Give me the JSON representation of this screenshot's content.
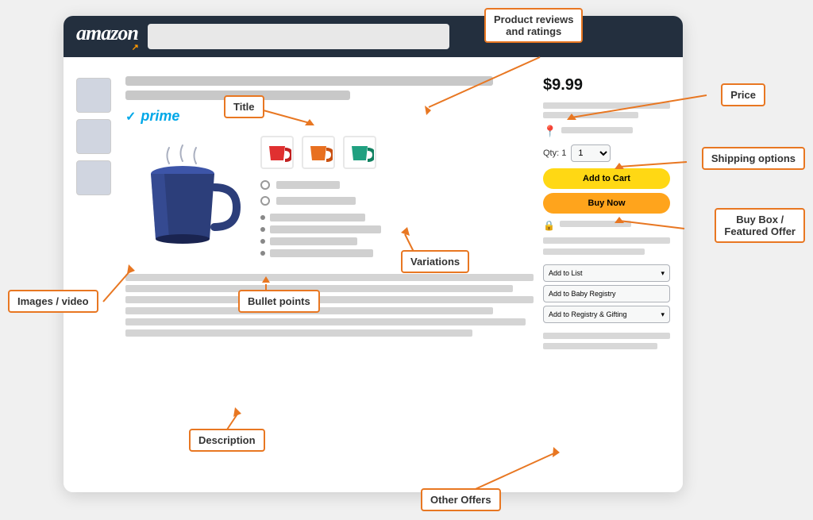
{
  "header": {
    "logo": "amazon",
    "logoSmile": "↗"
  },
  "annotations": {
    "title": "Title",
    "product_reviews": "Product reviews\nand ratings",
    "price": "Price",
    "shipping_options": "Shipping options",
    "buy_box": "Buy Box /\nFeatured Offer",
    "variations": "Variations",
    "images_video": "Images / video",
    "bullet_points": "Bullet points",
    "description": "Description",
    "other_offers": "Other Offers"
  },
  "product": {
    "price": "$9.99",
    "qty_label": "Qty: 1",
    "add_to_cart": "Add to Cart",
    "buy_now": "Buy Now",
    "add_to_list": "Add to List",
    "add_baby_registry": "Add to Baby Registry",
    "add_registry": "Add to Registry & Gifting"
  },
  "prime": {
    "checkmark": "✓",
    "text": "prime"
  },
  "colors": {
    "orange": "#e87722",
    "amazon_dark": "#232f3e",
    "prime_blue": "#00a8e8",
    "add_cart_yellow": "#ffd814",
    "buy_now_orange": "#ffa41c",
    "mug_body": "#2c3e7a",
    "mug_highlight": "#3d55a8",
    "mug_shadow": "#1a2450",
    "mug_red": "#e03030",
    "mug_orange": "#e87020",
    "mug_teal": "#20a080"
  }
}
